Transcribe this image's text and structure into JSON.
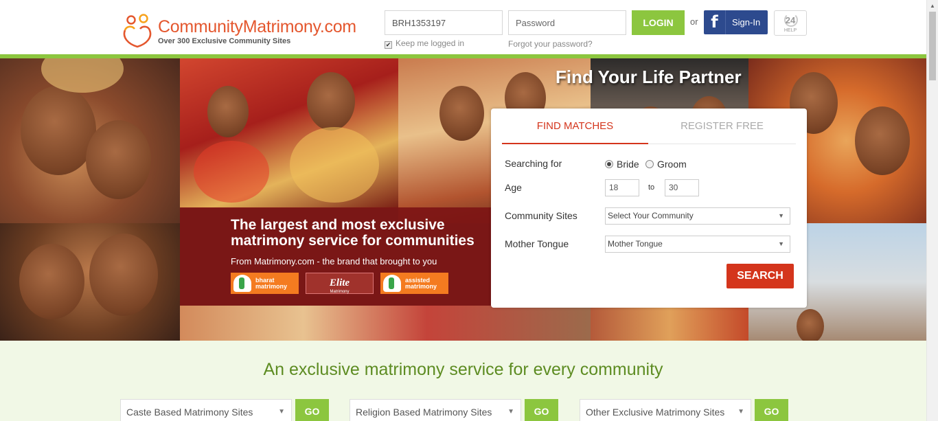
{
  "header": {
    "logo_text": "CommunityMatrimony.com",
    "logo_tagline": "Over 300 Exclusive Community Sites",
    "username_value": "BRH1353197",
    "password_placeholder": "Password",
    "login_label": "LOGIN",
    "or_text": "or",
    "fb_icon": "f",
    "fb_label": "Sign-In",
    "help_number": "24",
    "help_label": "HELP",
    "keep_logged_in": "Keep me logged in",
    "forgot_password": "Forgot your password?"
  },
  "hero": {
    "title": "Find Your Life Partner",
    "promo_heading": "The largest and most exclusive matrimony service for communities",
    "promo_sub": "From Matrimony.com - the brand that brought to you",
    "brands": {
      "bharat": "bharat matrimony",
      "elite": "Elite",
      "elite_sub": "Matrimony",
      "assisted": "assisted matrimony"
    }
  },
  "search_panel": {
    "tab_find": "FIND MATCHES",
    "tab_register": "REGISTER FREE",
    "searching_for_label": "Searching for",
    "option_bride": "Bride",
    "option_groom": "Groom",
    "selected": "Bride",
    "age_label": "Age",
    "age_from": "18",
    "age_to_text": "to",
    "age_to": "30",
    "community_label": "Community Sites",
    "community_select": "Select Your Community",
    "mother_tongue_label": "Mother Tongue",
    "mother_tongue_select": "Mother Tongue",
    "search_label": "SEARCH"
  },
  "bottom": {
    "title": "An exclusive matrimony service for every community",
    "selects": [
      "Caste Based Matrimony Sites",
      "Religion Based Matrimony Sites",
      "Other Exclusive Matrimony Sites"
    ],
    "go_label": "GO"
  },
  "colors": {
    "brand_orange": "#e4572e",
    "green": "#8cc63f",
    "red": "#d4351c",
    "facebook": "#2d4a8e",
    "promo_maroon": "#7d1414"
  },
  "icons": {
    "dropdown_arrow": "▼",
    "checkbox_check": "✔",
    "scroll_up": "▲"
  }
}
